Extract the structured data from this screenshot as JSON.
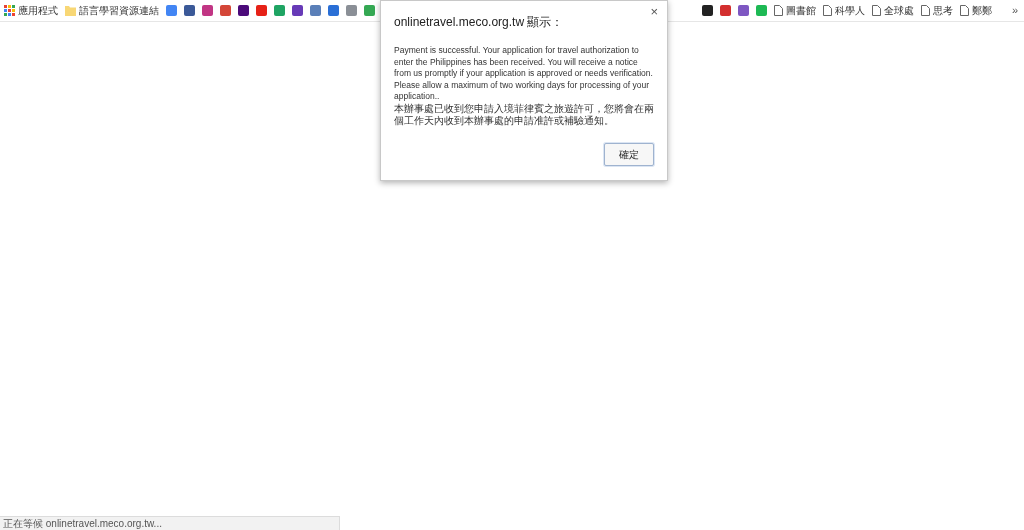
{
  "bookmarks_left": [
    {
      "kind": "apps",
      "label": "應用程式"
    },
    {
      "kind": "folder",
      "label": "語言學習資源連結"
    },
    {
      "kind": "favicon",
      "color": "#4285f4"
    },
    {
      "kind": "favicon",
      "color": "#3b5998"
    },
    {
      "kind": "favicon",
      "color": "#c13584"
    },
    {
      "kind": "favicon",
      "color": "#d44638"
    },
    {
      "kind": "favicon",
      "color": "#4b0a7a"
    },
    {
      "kind": "favicon",
      "color": "#e62117"
    },
    {
      "kind": "favicon",
      "color": "#1fa463"
    },
    {
      "kind": "favicon",
      "color": "#673ab7"
    },
    {
      "kind": "favicon",
      "color": "#5a7fb8"
    },
    {
      "kind": "favicon",
      "color": "#2a6fd6"
    },
    {
      "kind": "favicon",
      "color": "#8a8f96"
    },
    {
      "kind": "favicon",
      "color": "#34a853"
    }
  ],
  "bookmarks_right": [
    {
      "kind": "favicon",
      "color": "#222222"
    },
    {
      "kind": "favicon",
      "color": "#d32f2f"
    },
    {
      "kind": "favicon",
      "color": "#7e57c2"
    },
    {
      "kind": "favicon",
      "color": "#1db954"
    },
    {
      "kind": "page",
      "label": "圖書館"
    },
    {
      "kind": "page",
      "label": "科學人"
    },
    {
      "kind": "page",
      "label": "全球處"
    },
    {
      "kind": "page",
      "label": "思考"
    },
    {
      "kind": "page",
      "label": "鄭鄭"
    }
  ],
  "overflow": "»",
  "dialog": {
    "title": "onlinetravel.meco.org.tw 顯示：",
    "close": "×",
    "message": "Payment is successful. Your application for travel authorization to enter the Philippines has been received. You will receive a notice from us promptly if your application is approved or needs verification. Please allow a maximum of two working days for processing of your application..",
    "message_zh": "本辦事處已收到您申請入境菲律賓之旅遊許可，您將會在兩個工作天內收到本辦事處的申請准許或補驗通知。",
    "ok_button": "確定"
  },
  "status_bar": "正在等候 onlinetravel.meco.org.tw..."
}
